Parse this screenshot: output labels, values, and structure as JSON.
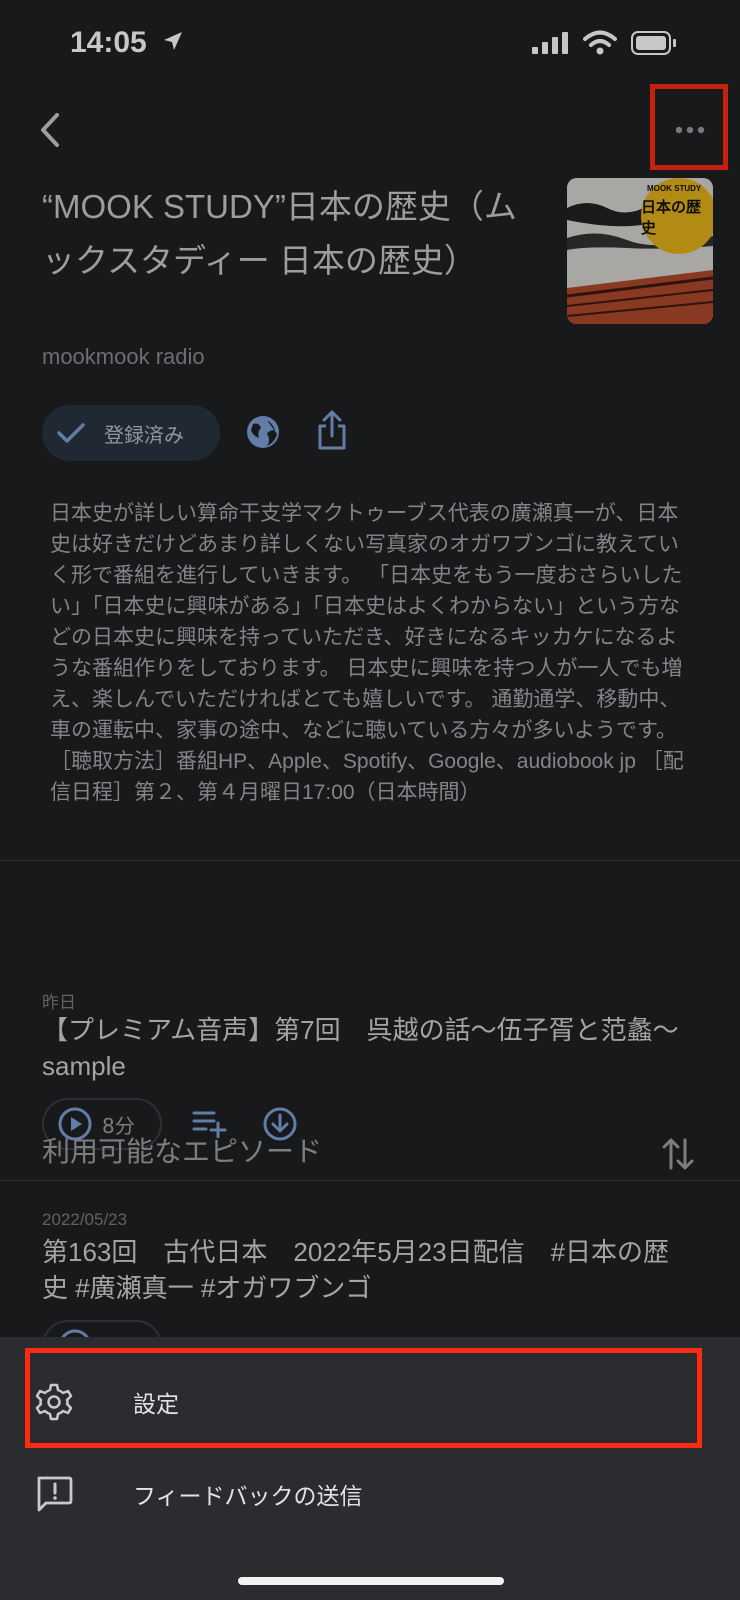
{
  "status_bar": {
    "time": "14:05",
    "icons": [
      "location-arrow-icon",
      "cellular-signal-icon",
      "wifi-icon",
      "battery-icon"
    ]
  },
  "header": {
    "back_icon": "chevron-left-icon",
    "more_icon": "more-horizontal-icon"
  },
  "podcast": {
    "title": "“MOOK STUDY”日本の歴史（ムックスタディー 日本の歴史）",
    "author": "mookmook radio",
    "artwork": {
      "brand": "MOOK STUDY",
      "title": "日本の歴史"
    },
    "subscribed_label": "登録済み",
    "description": "日本史が詳しい算命干支学マクトゥーブス代表の廣瀬真一が、日本史は好きだけどあまり詳しくない写真家のオガワブンゴに教えていく形で番組を進行していきます。 「日本史をもう一度おさらいしたい」「日本史に興味がある」「日本史はよくわからない」という方などの日本史に興味を持っていただき、好きになるキッカケになるような番組作りをしております。 日本史に興味を持つ人が一人でも増え、楽しんでいただければとても嬉しいです。 通勤通学、移動中、車の運転中、家事の途中、などに聴いている方々が多いようです。 ［聴取方法］番組HP、Apple、Spotify、Google、audiobook jp ［配信日程］第２、第４月曜日17:00（日本時間）"
  },
  "episodes": [
    {
      "date": "昨日",
      "title": "【プレミアム音声】第7回　呉越の話〜伍子胥と范蠡〜　sample",
      "duration": "8分"
    },
    {
      "date": "2022/05/23",
      "title": "第163回　古代日本　2022年5月23日配信　#日本の歴史 #廣瀬真一 #オガワブンゴ",
      "duration": ""
    }
  ],
  "available_heading": "利用可能なエピソード",
  "sheet": {
    "items": [
      {
        "label": "設定",
        "icon": "gear-icon"
      },
      {
        "label": "フィードバックの送信",
        "icon": "feedback-icon"
      }
    ]
  },
  "colors": {
    "background": "#1f2023",
    "sheet": "#2b2c30",
    "highlight": "#ff2a12",
    "accent": "#7ea1d6"
  }
}
